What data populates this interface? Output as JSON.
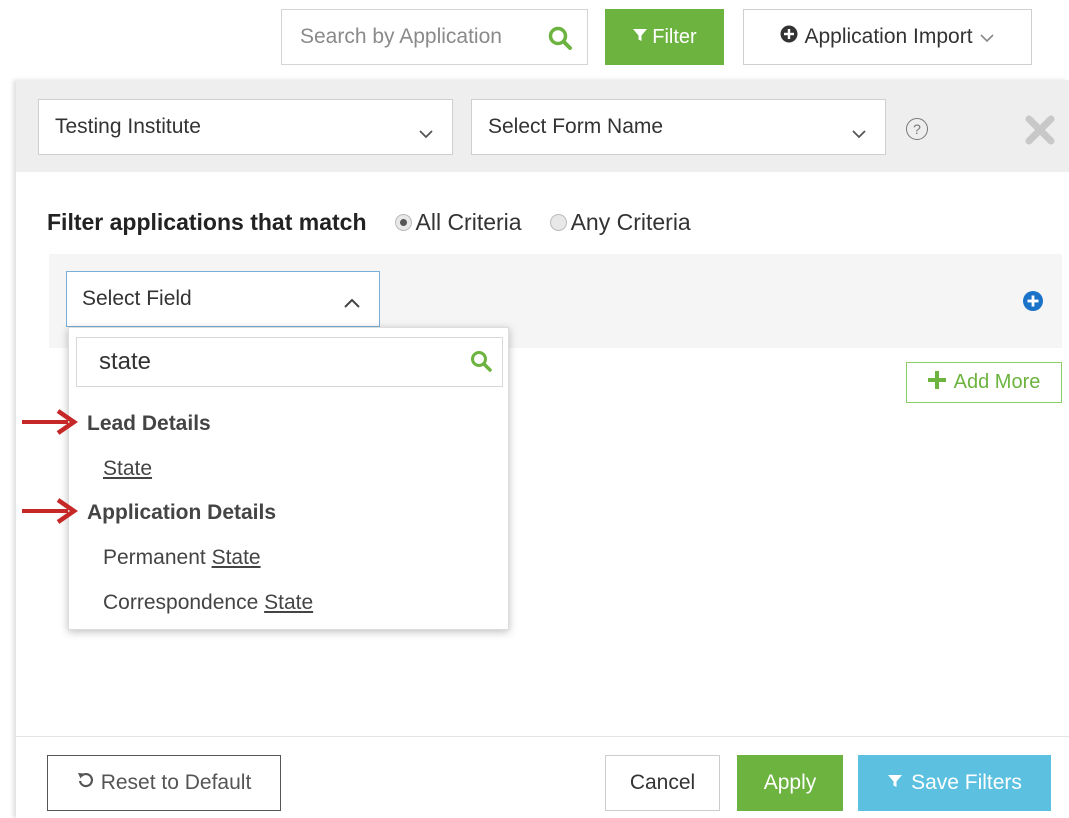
{
  "toolbar": {
    "search_placeholder": "Search by Application",
    "filter_label": "Filter",
    "import_label": "Application Import"
  },
  "panel": {
    "institute_select": "Testing Institute",
    "form_select": "Select Form Name",
    "help_glyph": "?",
    "match_label": "Filter applications that match",
    "radio_all": "All Criteria",
    "radio_any": "Any Criteria",
    "radio_selected": "All Criteria",
    "field_select": "Select Field",
    "add_more": "Add More"
  },
  "dropdown": {
    "search_value": "state",
    "groups": [
      {
        "label": "Lead Details",
        "items": [
          {
            "prefix": "",
            "match": "State"
          }
        ]
      },
      {
        "label": "Application Details",
        "items": [
          {
            "prefix": "Permanent ",
            "match": "State"
          },
          {
            "prefix": "Correspondence ",
            "match": "State"
          }
        ]
      }
    ]
  },
  "footer": {
    "reset_label": "Reset to Default",
    "cancel_label": "Cancel",
    "apply_label": "Apply",
    "save_label": "Save Filters"
  },
  "colors": {
    "green": "#6cb33f",
    "blue": "#5cc0e0",
    "arrow_red": "#c62828",
    "plus_blue": "#1a73c8"
  }
}
